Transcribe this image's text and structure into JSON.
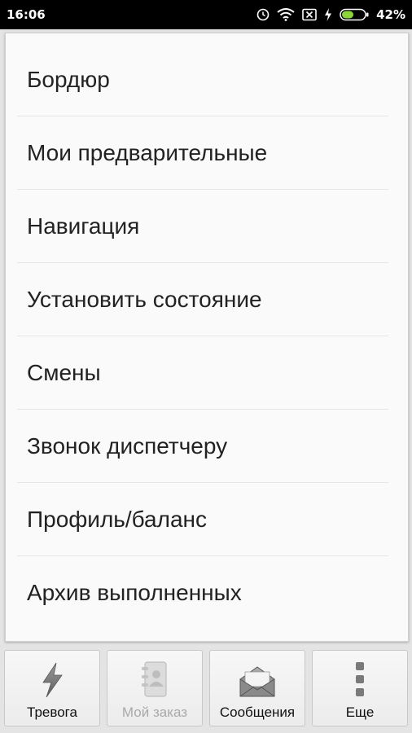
{
  "status_bar": {
    "time": "16:06",
    "battery_percent": "42%",
    "icons": [
      "alarm-icon",
      "wifi-icon",
      "no-sim-icon",
      "charging-icon",
      "battery-icon"
    ]
  },
  "menu": {
    "items": [
      {
        "label": "Бордюр"
      },
      {
        "label": "Мои предварительные"
      },
      {
        "label": "Навигация"
      },
      {
        "label": "Установить состояние"
      },
      {
        "label": "Смены"
      },
      {
        "label": "Звонок диспетчеру"
      },
      {
        "label": "Профиль/баланс"
      },
      {
        "label": "Архив выполненных"
      }
    ]
  },
  "bottom_tabs": [
    {
      "label": "Тревога",
      "icon": "lightning-icon",
      "enabled": true
    },
    {
      "label": "Мой заказ",
      "icon": "address-book-icon",
      "enabled": false
    },
    {
      "label": "Сообщения",
      "icon": "envelope-icon",
      "enabled": true
    },
    {
      "label": "Еще",
      "icon": "more-vertical-icon",
      "enabled": true
    }
  ],
  "colors": {
    "status_bar_bg": "#000000",
    "background": "#e4e4e4",
    "panel_bg": "#fafafa",
    "text": "#222222",
    "disabled_text": "#a9a9a9",
    "battery_green": "#8bd43c"
  }
}
